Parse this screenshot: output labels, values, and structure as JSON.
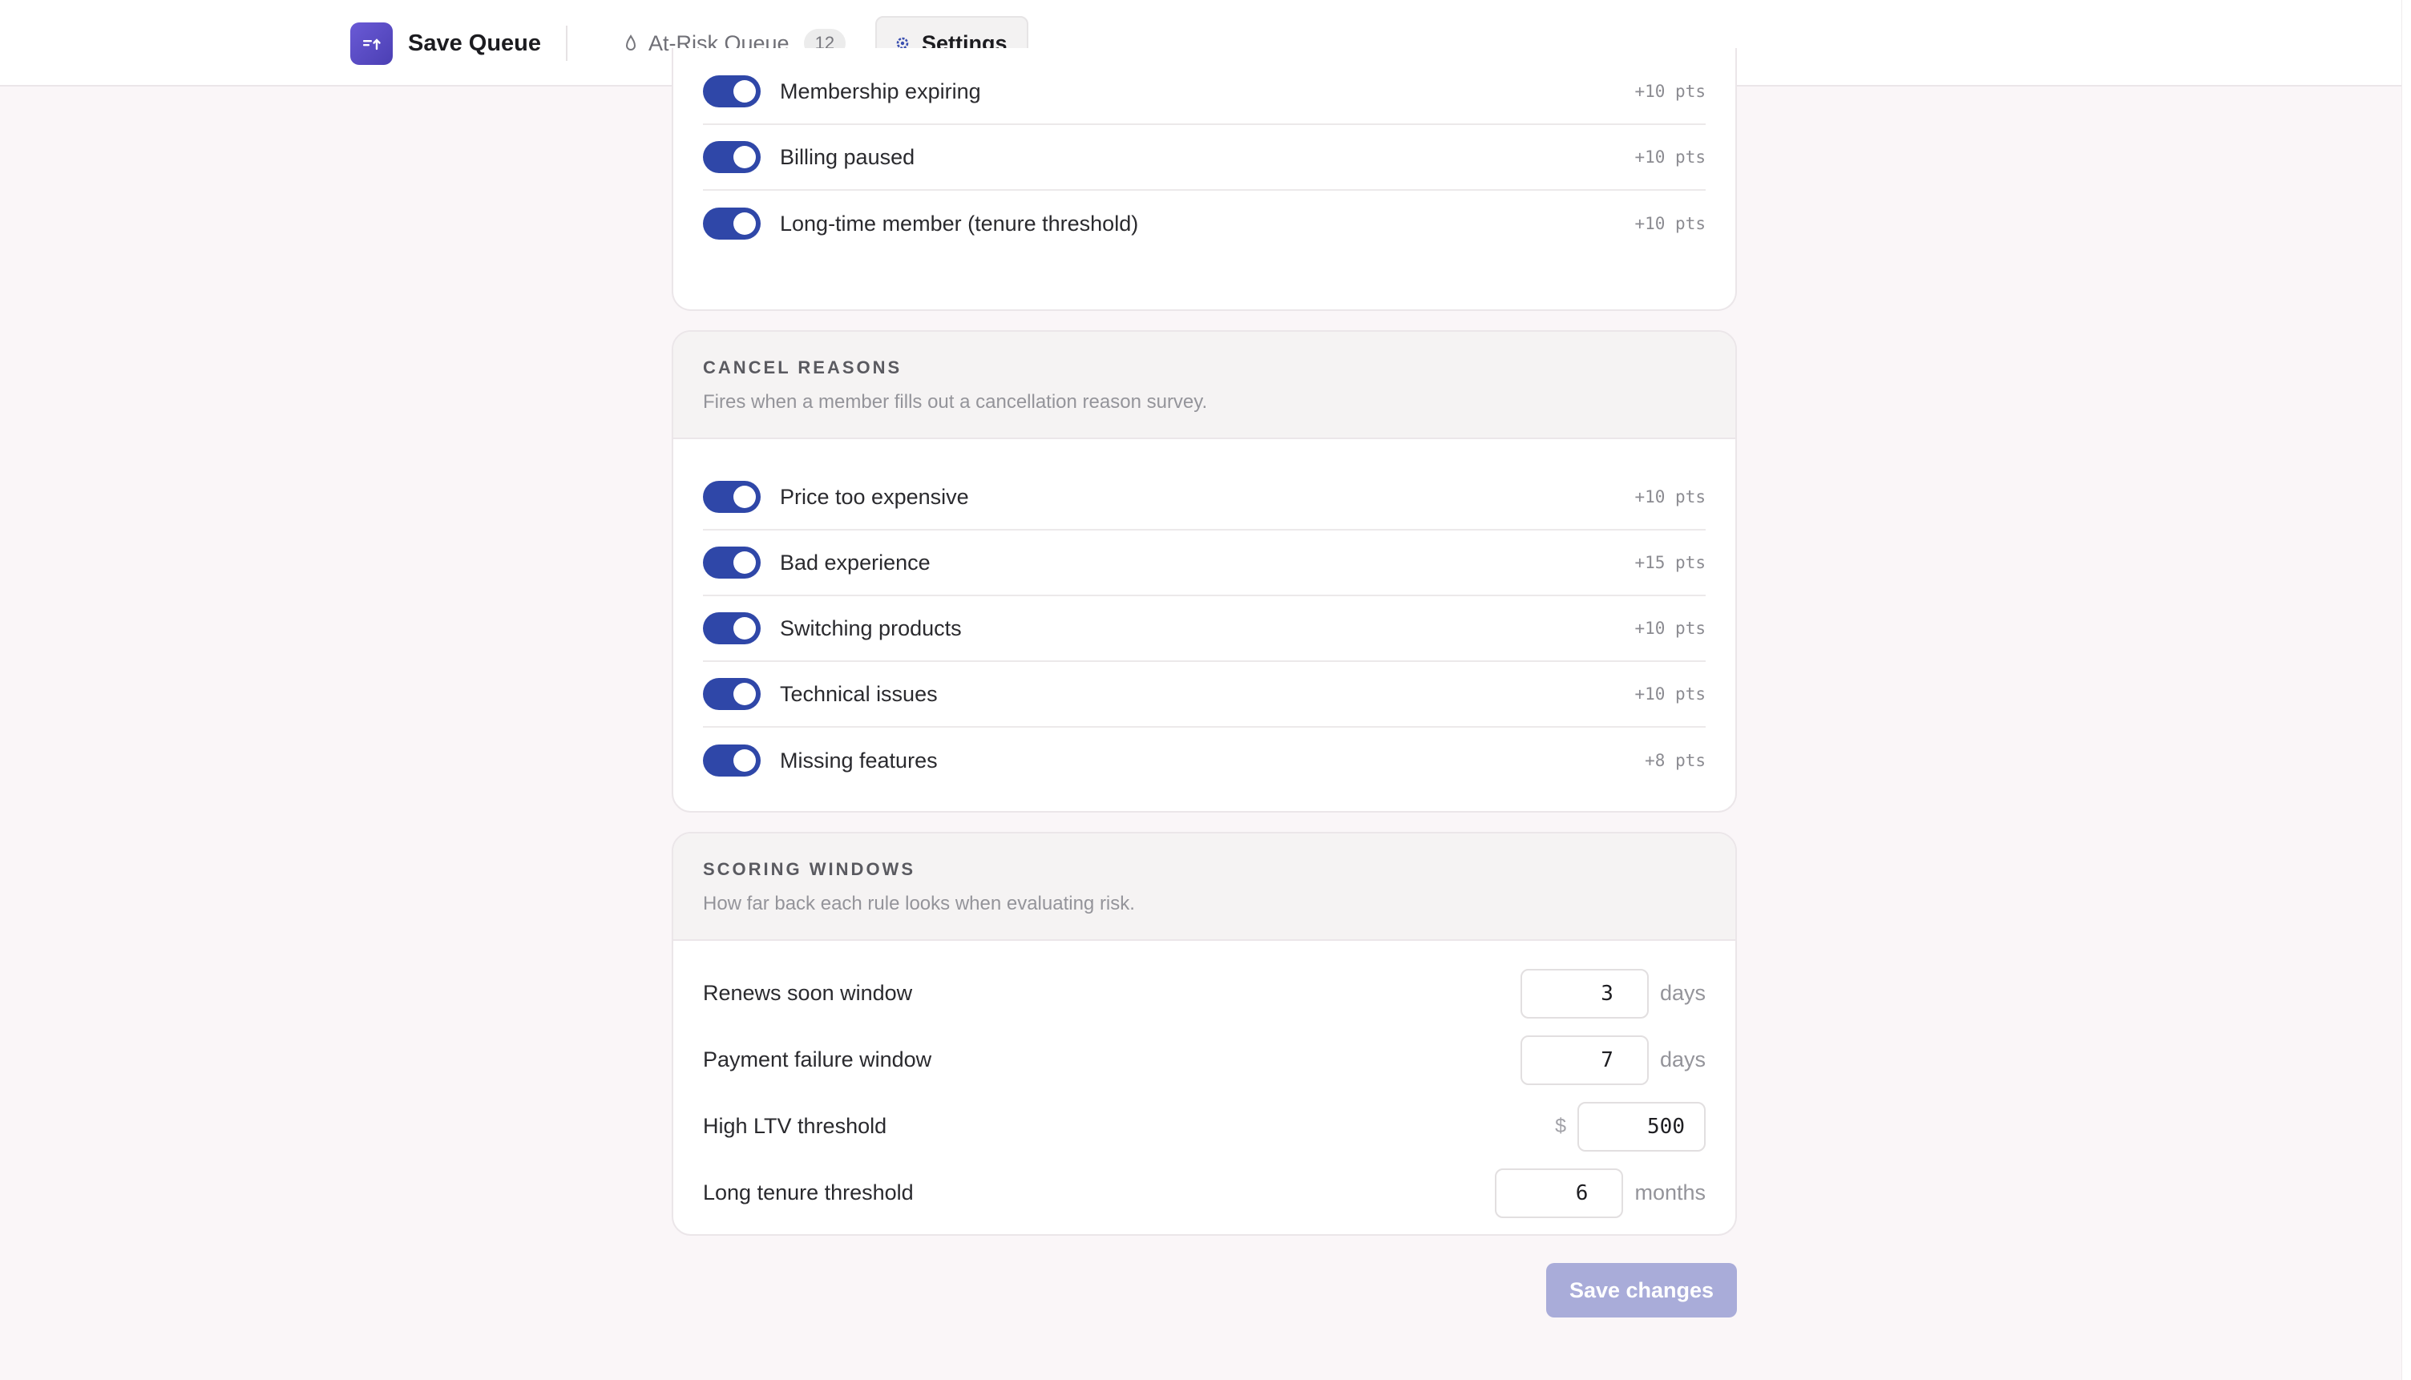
{
  "app": {
    "name": "Save Queue"
  },
  "nav": {
    "tabs": [
      {
        "label": "At-Risk Queue",
        "badge": "12",
        "icon": "droplet-icon"
      },
      {
        "label": "Settings",
        "icon": "gear-icon",
        "active": true
      }
    ]
  },
  "top_rules": {
    "items": [
      {
        "label": "Membership expiring",
        "points": "+10 pts",
        "enabled": true
      },
      {
        "label": "Billing paused",
        "points": "+10 pts",
        "enabled": true
      },
      {
        "label": "Long-time member (tenure threshold)",
        "points": "+10 pts",
        "enabled": true
      }
    ]
  },
  "cancel_reasons": {
    "title": "CANCEL REASONS",
    "description": "Fires when a member fills out a cancellation reason survey.",
    "items": [
      {
        "label": "Price too expensive",
        "points": "+10 pts",
        "enabled": true
      },
      {
        "label": "Bad experience",
        "points": "+15 pts",
        "enabled": true
      },
      {
        "label": "Switching products",
        "points": "+10 pts",
        "enabled": true
      },
      {
        "label": "Technical issues",
        "points": "+10 pts",
        "enabled": true
      },
      {
        "label": "Missing features",
        "points": "+8 pts",
        "enabled": true
      }
    ]
  },
  "scoring_windows": {
    "title": "SCORING WINDOWS",
    "description": "How far back each rule looks when evaluating risk.",
    "items": [
      {
        "label": "Renews soon window",
        "value": "3",
        "unit": "days"
      },
      {
        "label": "Payment failure window",
        "value": "7",
        "unit": "days"
      },
      {
        "label": "High LTV threshold",
        "value": "500",
        "prefix": "$"
      },
      {
        "label": "Long tenure threshold",
        "value": "6",
        "unit": "months"
      }
    ]
  },
  "actions": {
    "save_label": "Save changes"
  },
  "colors": {
    "accent": "#2f47a8",
    "brand": "#5b4cc8",
    "save_disabled": "#a9acd9"
  }
}
